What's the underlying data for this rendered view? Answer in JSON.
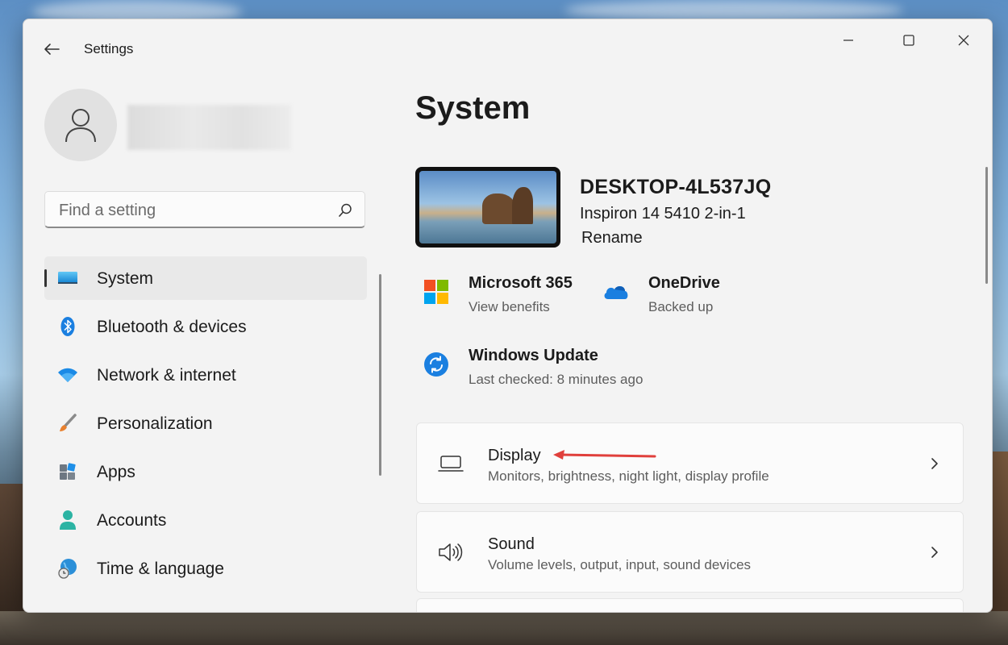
{
  "window": {
    "title": "Settings"
  },
  "search": {
    "placeholder": "Find a setting"
  },
  "sidebar": {
    "items": [
      {
        "label": "System",
        "icon": "system-icon",
        "active": true
      },
      {
        "label": "Bluetooth & devices",
        "icon": "bluetooth-icon"
      },
      {
        "label": "Network & internet",
        "icon": "wifi-icon"
      },
      {
        "label": "Personalization",
        "icon": "brush-icon"
      },
      {
        "label": "Apps",
        "icon": "apps-icon"
      },
      {
        "label": "Accounts",
        "icon": "person-icon"
      },
      {
        "label": "Time & language",
        "icon": "globe-clock-icon"
      }
    ]
  },
  "main": {
    "title": "System",
    "device": {
      "name": "DESKTOP-4L537JQ",
      "model": "Inspiron 14 5410 2-in-1",
      "rename_label": "Rename"
    },
    "tiles": {
      "m365": {
        "title": "Microsoft 365",
        "subtitle": "View benefits"
      },
      "onedrive": {
        "title": "OneDrive",
        "subtitle": "Backed up"
      },
      "update": {
        "title": "Windows Update",
        "subtitle": "Last checked: 8 minutes ago"
      }
    },
    "cards": [
      {
        "title": "Display",
        "subtitle": "Monitors, brightness, night light, display profile",
        "icon": "laptop-icon"
      },
      {
        "title": "Sound",
        "subtitle": "Volume levels, output, input, sound devices",
        "icon": "speaker-icon"
      }
    ]
  },
  "colors": {
    "accent": "#0067c0",
    "annotation_arrow": "#e0403c",
    "window_bg": "#f3f3f3"
  }
}
